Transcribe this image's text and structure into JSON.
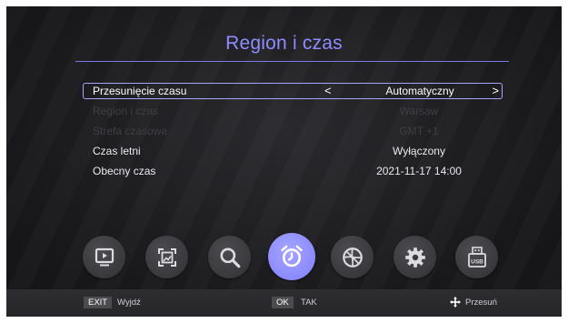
{
  "title": "Region i czas",
  "rows": [
    {
      "label": "Przesunięcie czasu",
      "value": "Automatyczny"
    },
    {
      "label": "Region i czas",
      "value": "Warsaw"
    },
    {
      "label": "Strefa czasowa",
      "value": "GMT +1"
    },
    {
      "label": "Czas letni",
      "value": "Wyłączony"
    },
    {
      "label": "Obecny czas",
      "value": "2021-11-17 14:00"
    }
  ],
  "arrows": {
    "left": "<",
    "right": ">"
  },
  "icons": [
    "tv-icon",
    "picture-icon",
    "search-icon",
    "alarm-clock-icon",
    "network-icon",
    "gear-icon",
    "usb-icon"
  ],
  "usb_text": "USB",
  "colors": {
    "accent": "#8f8cff",
    "active_icon": "#8b8aff"
  },
  "bottom": {
    "exit_key": "EXIT",
    "exit_label": "Wyjdź",
    "ok_key": "OK",
    "ok_label": "TAK",
    "move_label": "Przesuń"
  }
}
